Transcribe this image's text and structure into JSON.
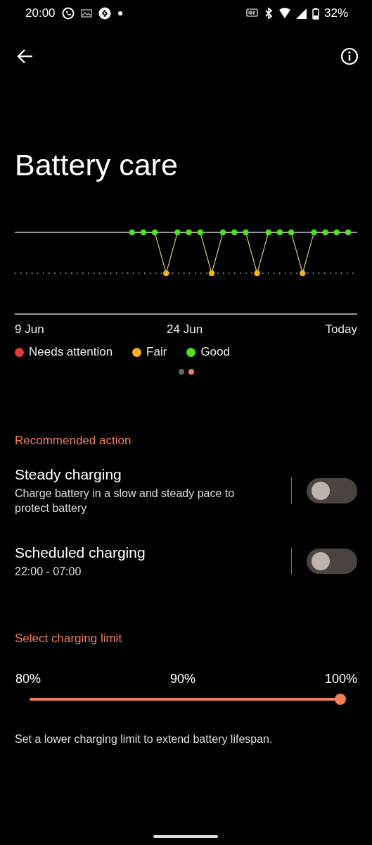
{
  "status_bar": {
    "time": "20:00",
    "battery": "32%"
  },
  "title": "Battery care",
  "chart": {
    "x_labels": [
      "9 Jun",
      "24 Jun",
      "Today"
    ],
    "points": [
      {
        "kind": "good"
      },
      {
        "kind": "good"
      },
      {
        "kind": "good"
      },
      {
        "kind": "fair"
      },
      {
        "kind": "good"
      },
      {
        "kind": "good"
      },
      {
        "kind": "good"
      },
      {
        "kind": "fair"
      },
      {
        "kind": "good"
      },
      {
        "kind": "good"
      },
      {
        "kind": "good"
      },
      {
        "kind": "fair"
      },
      {
        "kind": "good"
      },
      {
        "kind": "good"
      },
      {
        "kind": "good"
      },
      {
        "kind": "fair"
      },
      {
        "kind": "good"
      },
      {
        "kind": "good"
      },
      {
        "kind": "good"
      },
      {
        "kind": "good"
      }
    ]
  },
  "legend": [
    {
      "kind": "needs_attention",
      "label": "Needs attention",
      "color": "#e53935"
    },
    {
      "kind": "fair",
      "label": "Fair",
      "color": "#f5b21f"
    },
    {
      "kind": "good",
      "label": "Good",
      "color": "#4fe027"
    }
  ],
  "pager": [
    {
      "selected": false
    },
    {
      "selected": true
    }
  ],
  "recommended": {
    "heading": "Recommended action",
    "items": [
      {
        "title": "Steady charging",
        "subtitle": "Charge battery in a slow and steady pace to protect battery",
        "on": false
      },
      {
        "title": "Scheduled charging",
        "subtitle": "22:00 - 07:00",
        "on": false
      }
    ]
  },
  "limit": {
    "heading": "Select charging limit",
    "labels": [
      "80%",
      "90%",
      "100%"
    ],
    "level": 1,
    "note": "Set a lower charging limit to extend battery lifespan."
  }
}
